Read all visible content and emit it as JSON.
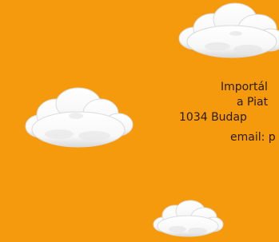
{
  "contact": {
    "company": "Importál",
    "street": "a Piat",
    "city": "1034 Budap",
    "email": "email: p"
  },
  "colors": {
    "background": "#F59A0D",
    "text": "#2B1A00",
    "cloud": "#FFFFFF"
  },
  "icons": {
    "top_right": "cloud-icon",
    "left": "cloud-icon",
    "bottom": "cloud-icon"
  }
}
